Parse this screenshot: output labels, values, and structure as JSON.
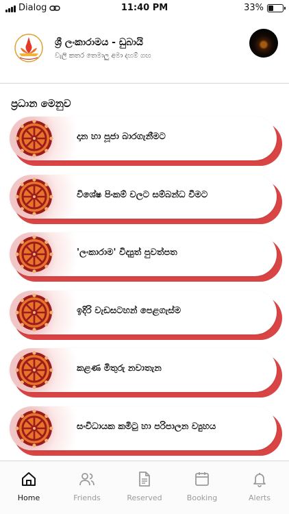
{
  "status_bar": {
    "carrier": "Dialog",
    "time": "11:40 PM",
    "battery": "33%",
    "battery_level": 0.33
  },
  "header": {
    "title": "ශ්‍රී ලංකාරාමය - ඩුබායි",
    "subtitle": "වැලි කතර තෙමාලු අමා දහම් ගඟ",
    "logo_icon": "temple-lotus-logo-icon",
    "avatar_icon": "user-avatar"
  },
  "section_title": "ප්‍රධාන මෙනුව",
  "menu": [
    {
      "label": "දාන හා පූජා බාරගැනීමට",
      "icon": "dharma-wheel-icon"
    },
    {
      "label": "විශේෂ පිංකම් වලට සම්බන්ධ වීමට",
      "icon": "dharma-wheel-icon"
    },
    {
      "label": "'ලංකාරාම' විද්‍යුත් පුවත්පත",
      "icon": "dharma-wheel-icon"
    },
    {
      "label": "ඉදිරි වැඩසටහන් පෙළගැස්ම",
      "icon": "dharma-wheel-icon"
    },
    {
      "label": "කළණ මිතුරු නවාතැන",
      "icon": "dharma-wheel-icon"
    },
    {
      "label": "සංවිධායක කමිටු හා පරිපාලන ව්‍යුහය",
      "icon": "dharma-wheel-icon"
    }
  ],
  "tabs": [
    {
      "label": "Home",
      "icon": "home-icon",
      "active": true
    },
    {
      "label": "Friends",
      "icon": "friends-icon",
      "active": false
    },
    {
      "label": "Reserved",
      "icon": "document-icon",
      "active": false
    },
    {
      "label": "Booking",
      "icon": "calendar-icon",
      "active": false
    },
    {
      "label": "Alerts",
      "icon": "bell-icon",
      "active": false
    }
  ],
  "colors": {
    "accent_red": "#d94545",
    "wheel_orange": "#e8732a",
    "wheel_dark": "#9b1c1c",
    "tab_inactive": "#9a9a9a"
  }
}
